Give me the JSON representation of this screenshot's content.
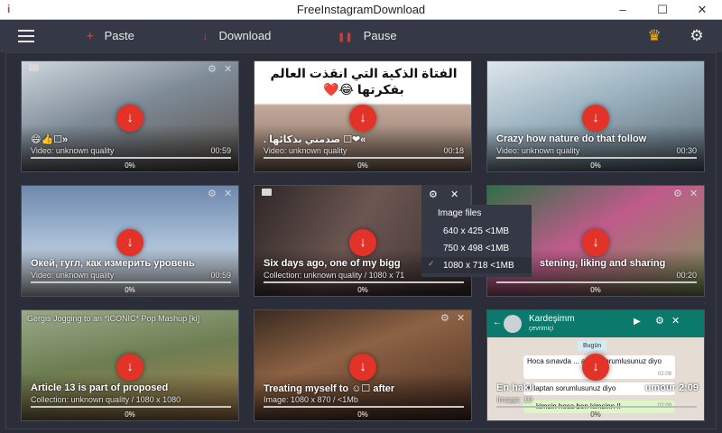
{
  "window": {
    "title": "FreeInstagramDownload",
    "minimize": "–",
    "maximize": "☐",
    "close": "✕"
  },
  "toolbar": {
    "paste_icon": "+",
    "paste_label": "Paste",
    "download_icon": "↓",
    "download_label": "Download",
    "pause_icon": "❚❚",
    "pause_label": "Pause",
    "crown_icon": "crown-icon",
    "settings_icon": "gear-icon"
  },
  "cards": [
    {
      "title": "😄👍☐»",
      "subtitle": "Video: unknown quality",
      "duration": "00:59",
      "percent": "0%",
      "bg": "#7f8a95"
    },
    {
      "title": ". صدمني بذكائها ☐❤«",
      "subtitle": "Video: unknown quality",
      "duration": "00:18",
      "percent": "0%",
      "bg": "#a49386",
      "caption": "الفتاة الذكية التي انقذت العالم بفكرتها 😂❤️"
    },
    {
      "title": "Crazy how nature do that follow",
      "subtitle": "Video: unknown quality",
      "duration": "00:30",
      "percent": "0%",
      "bg": "#6f7f8c"
    },
    {
      "title": "Окей, гугл, как измерить уровень",
      "subtitle": "Video: unknown quality",
      "duration": "00:59",
      "percent": "0%",
      "bg": "#7f95b2"
    },
    {
      "title": "Six days ago, one of my bigg",
      "subtitle": "Collection: unknown quality / 1080 x 71",
      "duration": "",
      "percent": "0%",
      "bg": "#5b4a48"
    },
    {
      "title": "stening, liking and sharing",
      "subtitle": "",
      "duration": "00:20",
      "percent": "0%",
      "bg": "#4a6d4e"
    },
    {
      "title": "Article 13 is part of proposed",
      "subtitle": "Collection: unknown quality / 1080 x 1080",
      "duration": "",
      "percent": "0%",
      "bg": "#8a9d6a",
      "caption": "Gergis Jogging to an *ICONIC* Pop Mashup [ki]"
    },
    {
      "title": "Treating myself to ☺☐ after",
      "subtitle": "Image: 1080 x 870 / <1Mb",
      "duration": "",
      "percent": "0%",
      "bg": "#6b4a36"
    },
    {
      "title": "En hakli",
      "subtitle": "Image: 10",
      "duration": "",
      "percent": "0%",
      "bg": "#e3ddd2",
      "chat": {
        "name": "Kardeşimm",
        "status": "çevrimiçi",
        "day": "Bugün",
        "m1": "Hoca sınavda ... aptan sorumlusunuz diyo",
        "t1": "02:09",
        "m2": "umour 2:09",
        "m3": "Kitaptan sorumlusunuz diyo",
        "t3": "02:09",
        "m4": "kimsin hoca ben kimsinn !!",
        "t4": "02:09"
      }
    }
  ],
  "popup": {
    "header": "Image files",
    "options": [
      "640 x 425 <1MB",
      "750 x 498 <1MB",
      "1080 x 718 <1MB"
    ],
    "check": "✓"
  }
}
